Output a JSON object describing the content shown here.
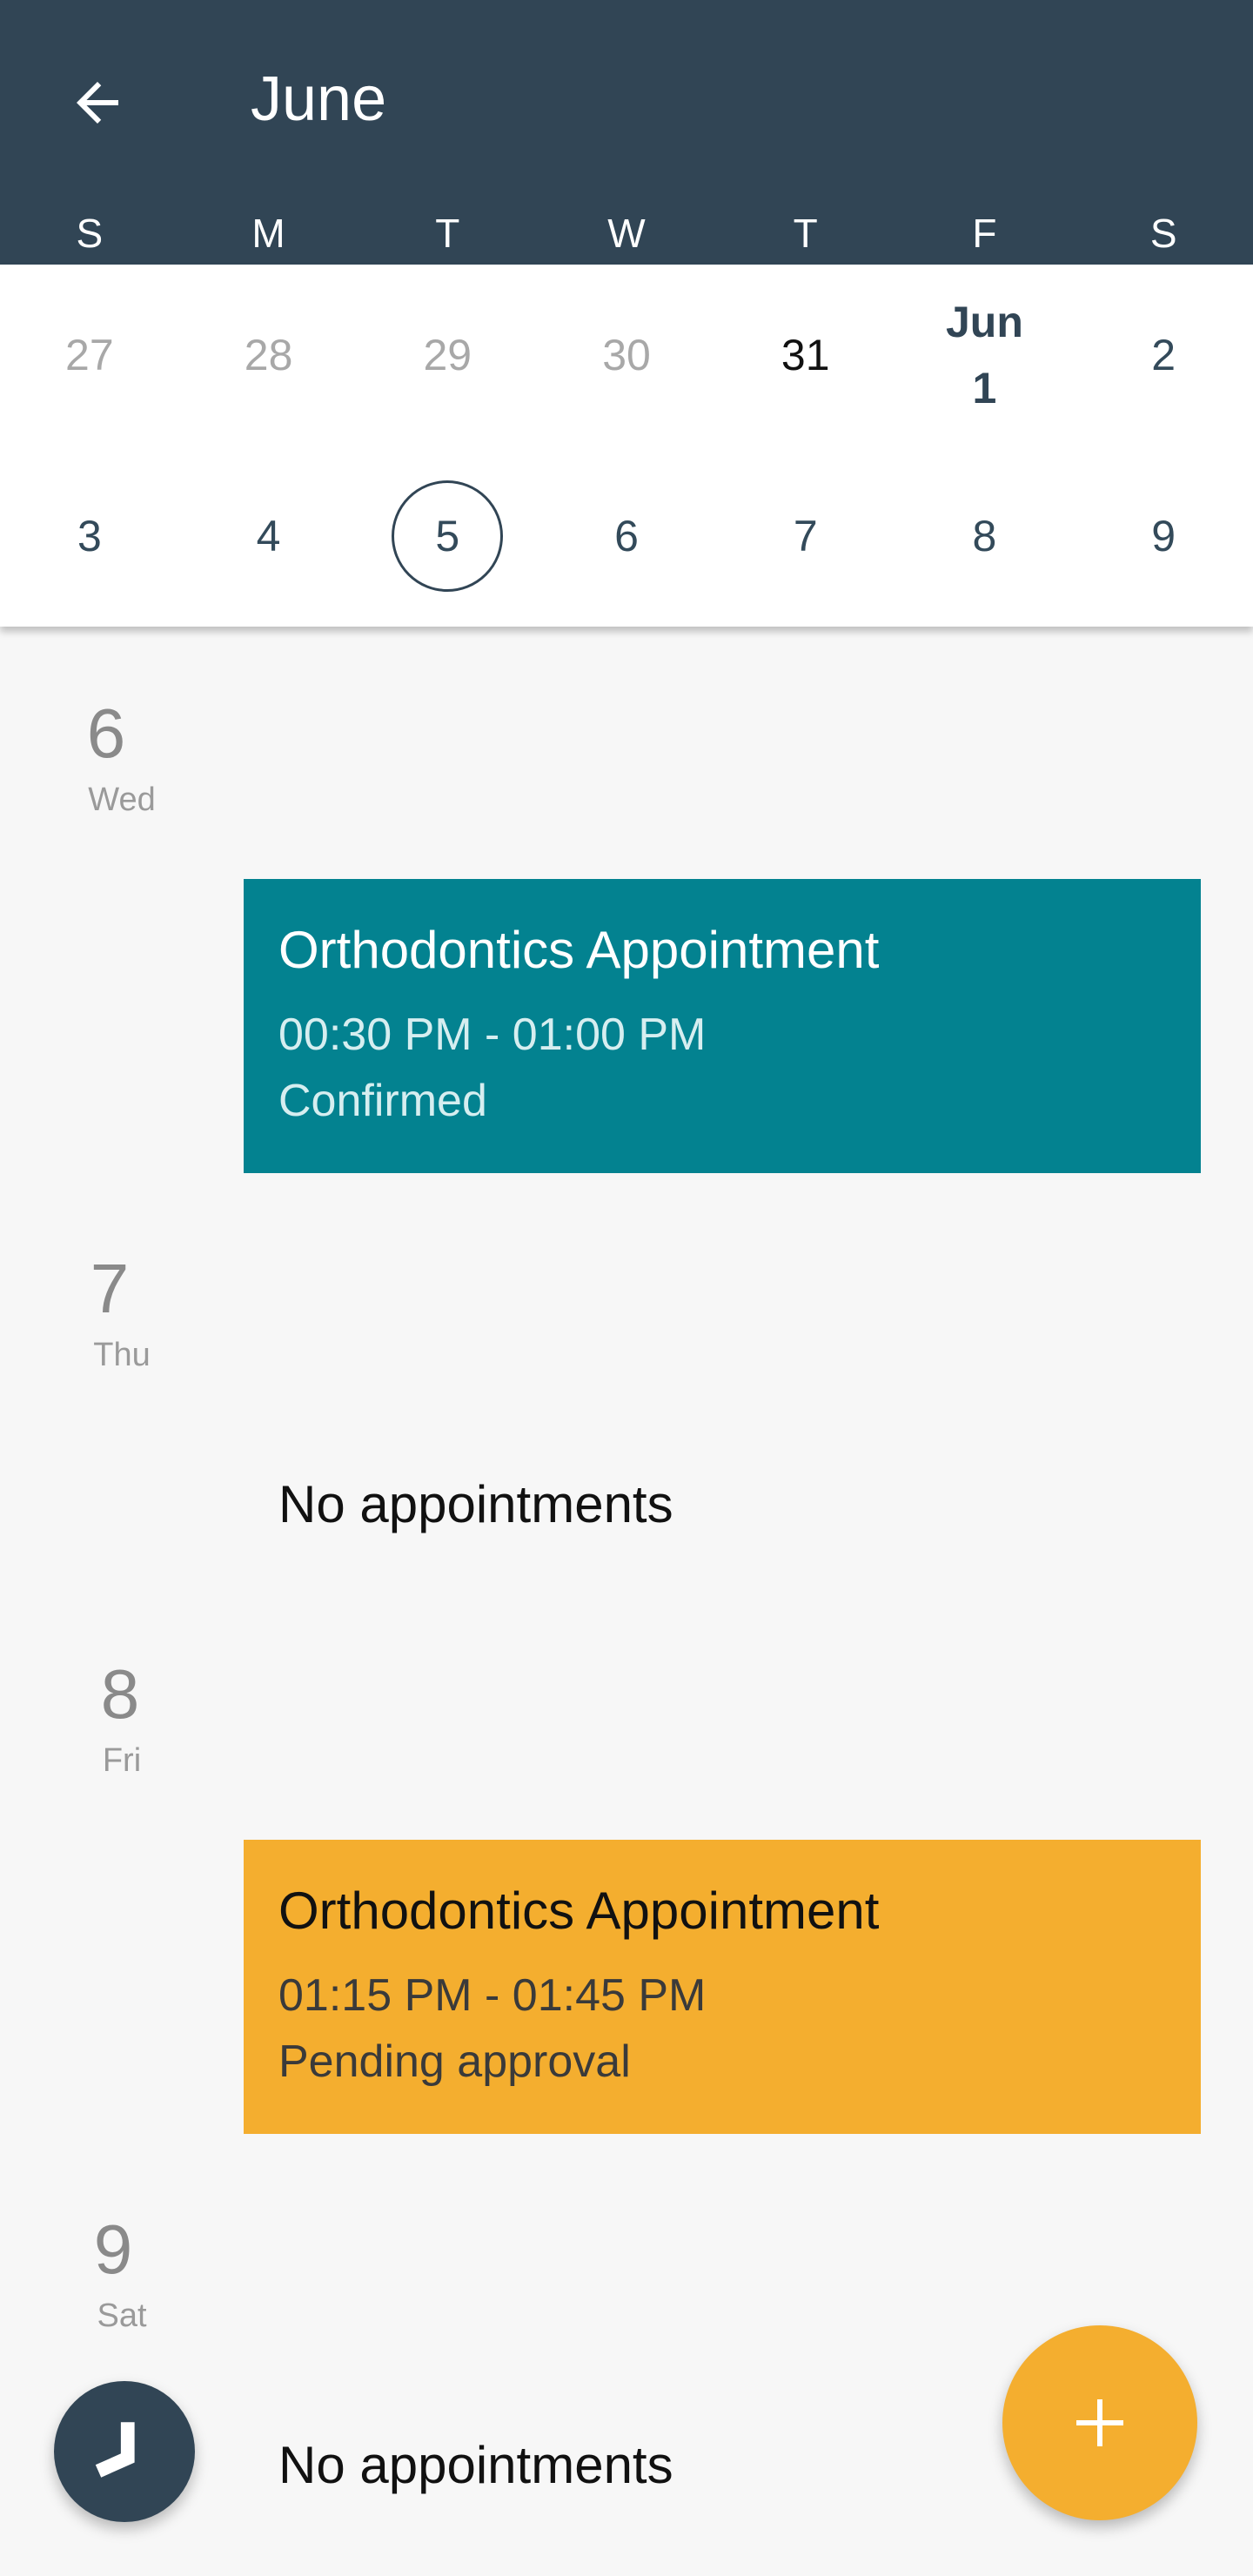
{
  "header": {
    "title": "June",
    "back_icon": "arrow-left-icon",
    "weekdays": [
      "S",
      "M",
      "T",
      "W",
      "T",
      "F",
      "S"
    ],
    "background_color": "#314555"
  },
  "calendar": {
    "row1": [
      {
        "label": "27",
        "state": "muted"
      },
      {
        "label": "28",
        "state": "muted"
      },
      {
        "label": "29",
        "state": "muted"
      },
      {
        "label": "30",
        "state": "muted"
      },
      {
        "label": "31",
        "state": "dark"
      },
      {
        "label_month": "Jun",
        "label_day": "1",
        "state": "month-start"
      },
      {
        "label": "2",
        "state": "normal"
      }
    ],
    "row2": [
      {
        "label": "3",
        "state": "normal"
      },
      {
        "label": "4",
        "state": "normal"
      },
      {
        "label": "5",
        "state": "selected"
      },
      {
        "label": "6",
        "state": "normal"
      },
      {
        "label": "7",
        "state": "normal"
      },
      {
        "label": "8",
        "state": "normal"
      },
      {
        "label": "9",
        "state": "normal"
      }
    ]
  },
  "agenda": {
    "days": [
      {
        "day_num": "6",
        "day_name": "Wed"
      },
      {
        "day_num": "7",
        "day_name": "Thu"
      },
      {
        "day_num": "8",
        "day_name": "Fri"
      },
      {
        "day_num": "9",
        "day_name": "Sat"
      }
    ],
    "appointments": [
      {
        "title": "Orthodontics Appointment",
        "time": "00:30 PM - 01:00 PM",
        "status": "Confirmed",
        "color": "#038290"
      },
      {
        "title": "Orthodontics Appointment",
        "time": "01:15 PM - 01:45 PM",
        "status": "Pending approval",
        "color": "#f4ae2f"
      }
    ],
    "no_appointments_label": "No appointments"
  },
  "fab": {
    "icon": "plus-icon",
    "color": "#f4ae2f"
  },
  "clock_button": {
    "icon": "clock-icon",
    "color": "#314555"
  }
}
